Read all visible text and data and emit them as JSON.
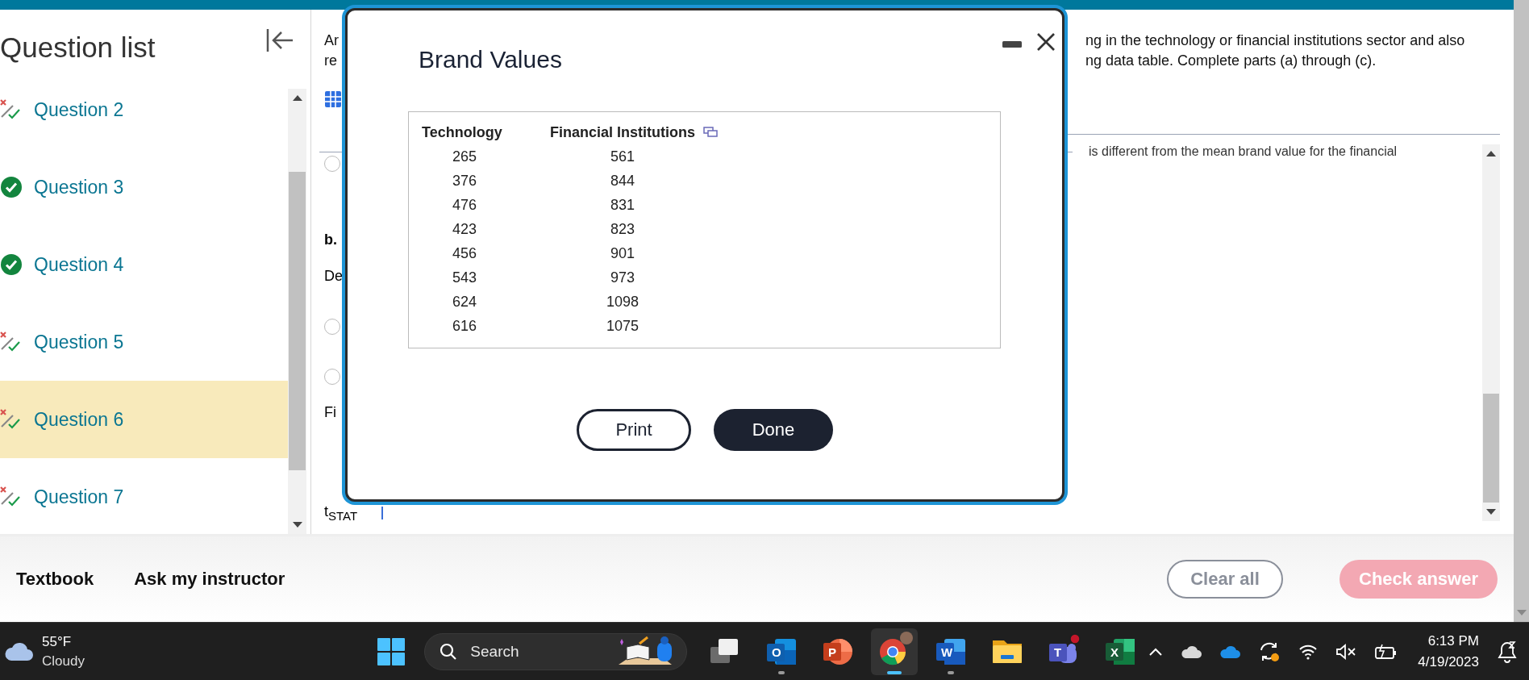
{
  "question_list": {
    "title": "Question list",
    "items": [
      {
        "label": "Question 2",
        "kind": "partial",
        "selected": false
      },
      {
        "label": "Question 3",
        "kind": "correct",
        "selected": false
      },
      {
        "label": "Question 4",
        "kind": "correct",
        "selected": false
      },
      {
        "label": "Question 5",
        "kind": "partial",
        "selected": false
      },
      {
        "label": "Question 6",
        "kind": "partial",
        "selected": true
      },
      {
        "label": "Question 7",
        "kind": "partial",
        "selected": false
      }
    ]
  },
  "question": {
    "intro_left": [
      "Ar",
      "re"
    ],
    "intro_right": [
      "ng in the technology or financial institutions sector and also",
      "ng data table. Complete parts (a) through (c)."
    ],
    "scroll_text": "is different from the mean brand value for the financial",
    "left_items": [
      {
        "kind": "radio",
        "selected": false
      },
      {
        "kind": "bold",
        "text": "b."
      },
      {
        "kind": "text",
        "text": "De"
      },
      {
        "kind": "radio",
        "selected": false
      },
      {
        "kind": "radio",
        "selected": false
      },
      {
        "kind": "text",
        "text": "Fi"
      },
      {
        "kind": "stat",
        "text": "t$_{STAT}$"
      }
    ]
  },
  "dialog": {
    "title": "Brand Values",
    "columns": [
      "Technology",
      "Financial Institutions"
    ],
    "rows": [
      [
        "265",
        "561"
      ],
      [
        "376",
        "844"
      ],
      [
        "476",
        "831"
      ],
      [
        "423",
        "823"
      ],
      [
        "456",
        "901"
      ],
      [
        "543",
        "973"
      ],
      [
        "624",
        "1098"
      ],
      [
        "616",
        "1075"
      ]
    ],
    "buttons": [
      {
        "label": "Print",
        "kind": "secondary"
      },
      {
        "label": "Done",
        "kind": "primary"
      }
    ]
  },
  "footer": {
    "links": [
      "Textbook",
      "Ask my instructor"
    ],
    "buttons": [
      {
        "label": "Clear all",
        "kind": "outline",
        "disabled": false
      },
      {
        "label": "Check answer",
        "kind": "primary",
        "disabled": true
      }
    ]
  },
  "taskbar": {
    "weather": {
      "temperature": "55°F",
      "condition": "Cloudy"
    },
    "search": {
      "placeholder": "Search"
    },
    "apps": [
      {
        "kind": "taskview",
        "running": false,
        "selected": false,
        "badge": false
      },
      {
        "kind": "mail",
        "glyph": "O",
        "running": true,
        "selected": false,
        "badge": false
      },
      {
        "kind": "slides",
        "glyph": "P",
        "running": false,
        "selected": false,
        "badge": false
      },
      {
        "kind": "browser",
        "running": true,
        "selected": true,
        "badge": false
      },
      {
        "kind": "document",
        "glyph": "W",
        "running": true,
        "selected": false,
        "badge": false
      },
      {
        "kind": "folder",
        "running": false,
        "selected": false,
        "badge": false
      },
      {
        "kind": "chat",
        "glyph": "T",
        "running": false,
        "selected": false,
        "badge": true
      },
      {
        "kind": "sheet",
        "glyph": "X",
        "running": false,
        "selected": false,
        "badge": false
      }
    ],
    "time": "6:13 PM",
    "date": "4/19/2023"
  }
}
